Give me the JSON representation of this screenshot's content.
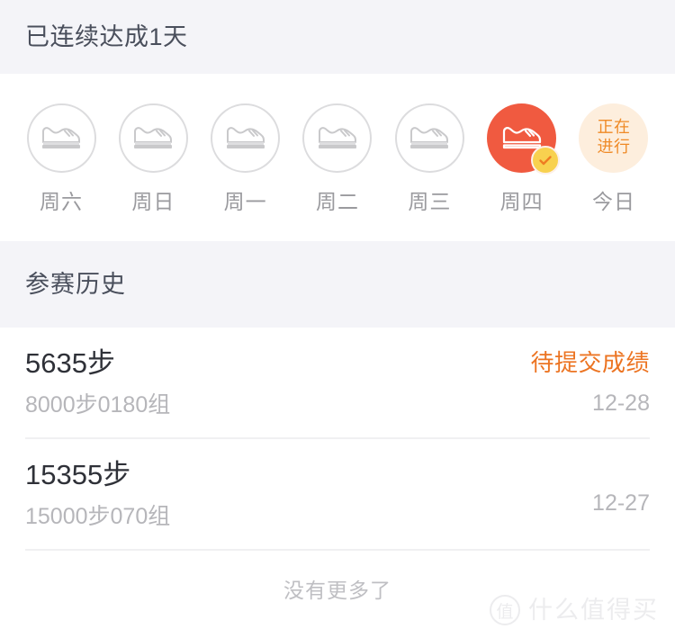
{
  "streak": {
    "title": "已连续达成1天"
  },
  "week": {
    "days": [
      {
        "label": "周六",
        "state": "inactive",
        "icon": "shoe-icon"
      },
      {
        "label": "周日",
        "state": "inactive",
        "icon": "shoe-icon"
      },
      {
        "label": "周一",
        "state": "inactive",
        "icon": "shoe-icon"
      },
      {
        "label": "周二",
        "state": "inactive",
        "icon": "shoe-icon"
      },
      {
        "label": "周三",
        "state": "inactive",
        "icon": "shoe-icon"
      },
      {
        "label": "周四",
        "state": "active",
        "icon": "shoe-icon",
        "badge": "check-icon"
      },
      {
        "label": "今日",
        "state": "today",
        "badge_line1": "正在",
        "badge_line2": "进行"
      }
    ]
  },
  "history": {
    "section_title": "参赛历史",
    "rows": [
      {
        "steps": "5635步",
        "detail": "8000步0180组",
        "status": "待提交成绩",
        "date": "12-28"
      },
      {
        "steps": "15355步",
        "detail": "15000步070组",
        "status": "",
        "date": "12-27"
      }
    ],
    "footer": "没有更多了"
  },
  "watermark": {
    "badge": "值",
    "text": "什么值得买"
  },
  "colors": {
    "accent_orange": "#ec7422",
    "active_circle": "#f05a40",
    "today_circle": "#fdeedd",
    "check_badge": "#f8d14f",
    "band_bg": "#f4f4f8"
  }
}
